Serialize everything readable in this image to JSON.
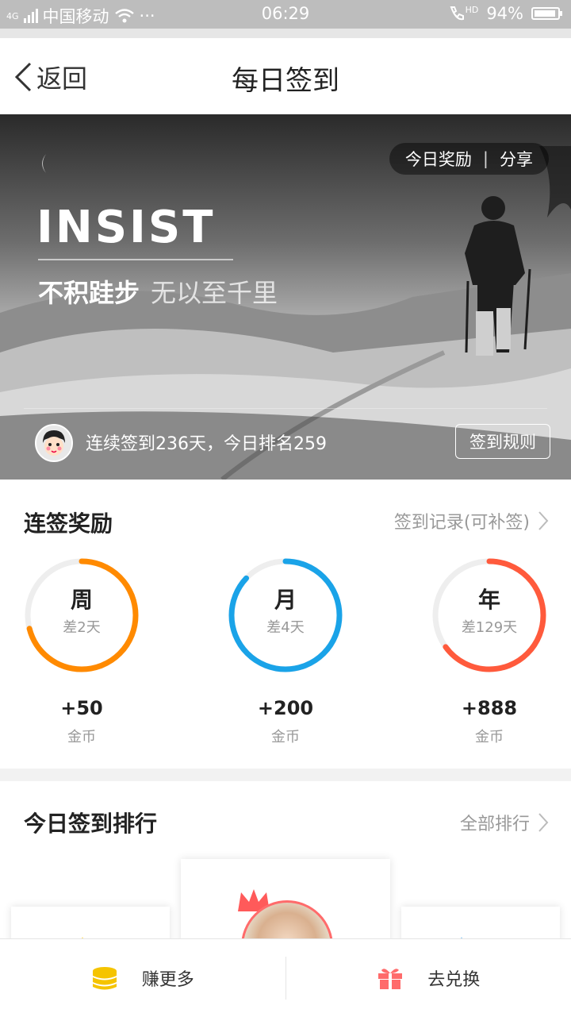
{
  "status_bar": {
    "carrier": "中国移动",
    "network": "4G",
    "dots": "···",
    "time": "06:29",
    "hd": "HD",
    "battery": "94%",
    "battery_level": 0.94
  },
  "nav": {
    "back_label": "返回",
    "title": "每日签到"
  },
  "banner": {
    "today_reward": "今日奖励",
    "separator": "|",
    "share": "分享",
    "headline": "INSIST",
    "slogan_bold": "不积跬步",
    "slogan_light": "无以至千里",
    "checkin_info": "连续签到236天，今日排名259",
    "rules_button": "签到规则"
  },
  "rewards": {
    "title": "连签奖励",
    "record_link": "签到记录(可补签)",
    "items": [
      {
        "label": "周",
        "remain": "差2天",
        "amount": "+50",
        "unit": "金币",
        "color": "#ff8a00",
        "progress": 0.71
      },
      {
        "label": "月",
        "remain": "差4天",
        "amount": "+200",
        "unit": "金币",
        "color": "#1aa3e8",
        "progress": 0.87
      },
      {
        "label": "年",
        "remain": "差129天",
        "amount": "+888",
        "unit": "金币",
        "color": "#ff5a3c",
        "progress": 0.65
      }
    ]
  },
  "ranking": {
    "title": "今日签到排行",
    "all_link": "全部排行"
  },
  "bottom": {
    "earn_more": "赚更多",
    "redeem": "去兑换"
  }
}
